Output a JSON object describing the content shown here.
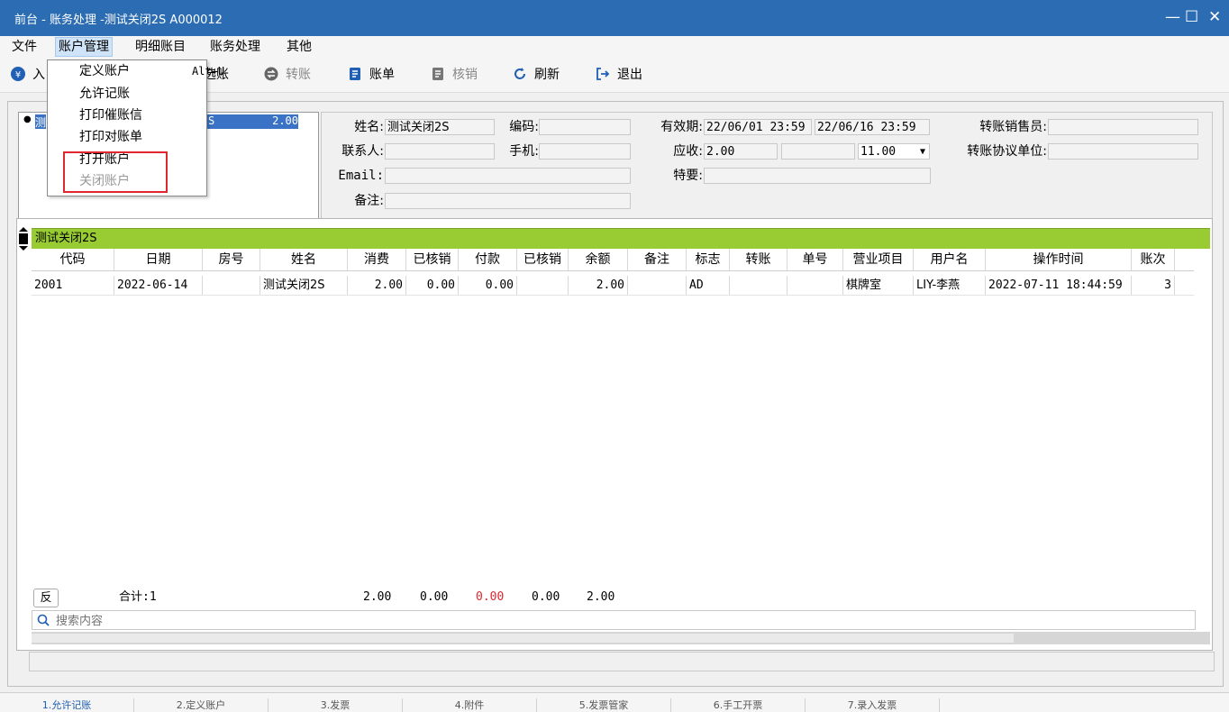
{
  "window": {
    "title": "前台 - 账务处理 -测试关闭2S  A000012",
    "minimize": "—",
    "maximize": "☐",
    "close": "✕"
  },
  "menu": [
    "文件",
    "账户管理",
    "明细账目",
    "账务处理",
    "其他"
  ],
  "toolbar": {
    "first_label": "入",
    "select_label": "选账",
    "transfer_label": "转账",
    "bill_label": "账单",
    "writeoff_label": "核销",
    "refresh_label": "刷新",
    "exit_label": "退出"
  },
  "dropdown": {
    "items": [
      {
        "label": "定义账户",
        "shortcut": "Alt+U",
        "enabled": true
      },
      {
        "label": "允许记账",
        "enabled": true
      },
      {
        "label": "打印催账信",
        "enabled": true
      },
      {
        "label": "打印对账单",
        "enabled": true
      },
      {
        "label": "打开账户",
        "enabled": true
      },
      {
        "label": "关闭账户",
        "enabled": false
      }
    ]
  },
  "account_list": {
    "row_name_visible": "测",
    "row_name_tail": "S",
    "row_amount": "2.00"
  },
  "form": {
    "name_label": "姓名:",
    "name_value": "测试关闭2S",
    "code_label": "编码:",
    "code_value": "",
    "valid_label": "有效期:",
    "valid_from": "22/06/01 23:59",
    "valid_to": "22/06/16 23:59",
    "sales_label": "转账销售员:",
    "sales_value": "",
    "contact_label": "联系人:",
    "contact_value": "",
    "mobile_label": "手机:",
    "mobile_value": "",
    "receivable_label": "应收:",
    "receivable_value": "2.00",
    "receivable_extra": "",
    "limit_value": "11.00",
    "agreement_label": "转账协议单位:",
    "agreement_value": "",
    "email_label": "Email:",
    "email_value": "",
    "special_label": "特要:",
    "special_value": "",
    "remark_label": "备注:",
    "remark_value": ""
  },
  "grid": {
    "group_title": "测试关闭2S",
    "columns": [
      "代码",
      "日期",
      "房号",
      "姓名",
      "消费",
      "已核销",
      "付款",
      "已核销",
      "余额",
      "备注",
      "标志",
      "转账",
      "单号",
      "营业项目",
      "用户名",
      "操作时间",
      "账次"
    ],
    "row": [
      "2001",
      "2022-06-14",
      "",
      "测试关闭2S",
      "2.00",
      "0.00",
      "0.00",
      "",
      "2.00",
      "",
      "AD",
      "",
      "",
      "棋牌室",
      "LIY-李燕",
      "2022-07-11 18:44:59",
      "3"
    ]
  },
  "summary": {
    "reverse_label": "反",
    "count_label": "合计:1",
    "consume": "2.00",
    "written_off": "0.00",
    "payment": "0.00",
    "written_off2": "0.00",
    "balance": "2.00"
  },
  "search": {
    "placeholder": "搜索内容"
  },
  "bottom_tabs": [
    "1.允许记账",
    "2.定义账户",
    "3.发票",
    "4.附件",
    "5.发票管家",
    "6.手工开票",
    "7.录入发票"
  ],
  "colors": {
    "title_bar": "#2b6cb3",
    "group_bar": "#99cc33",
    "highlight": "#e0262f",
    "payment_total": "#e0262f"
  }
}
